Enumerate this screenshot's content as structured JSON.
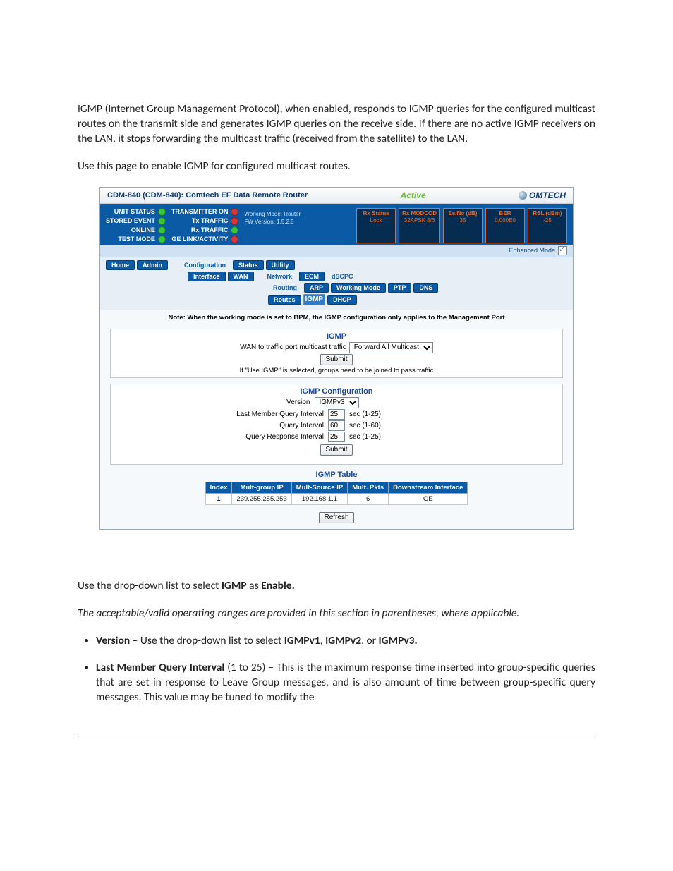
{
  "intro": {
    "p1": "IGMP (Internet Group Management Protocol), when enabled, responds to IGMP queries for the configured multicast routes on the transmit side and generates IGMP queries on the receive side. If there are no active IGMP receivers on the LAN, it stops forwarding the multicast traffic (received from the satellite) to the LAN.",
    "p2": "Use this page to enable IGMP for configured multicast routes."
  },
  "topbar": {
    "title": "CDM-840 (CDM-840): Comtech EF Data Remote Router",
    "active": "Active",
    "logo": "OMTECH"
  },
  "status": {
    "col1": [
      {
        "label": "UNIT STATUS",
        "led": "green"
      },
      {
        "label": "STORED EVENT",
        "led": "green"
      },
      {
        "label": "ONLINE",
        "led": "green"
      },
      {
        "label": "TEST MODE",
        "led": "green"
      }
    ],
    "col2": [
      {
        "label": "TRANSMITTER ON",
        "led": "red"
      },
      {
        "label": "Tx TRAFFIC",
        "led": "red"
      },
      {
        "label": "Rx TRAFFIC",
        "led": "green"
      },
      {
        "label": "GE LINK/ACTIVITY",
        "led": "red"
      }
    ],
    "mid1": "Working Mode: Router",
    "mid2": "FW Version: 1.5.2.5",
    "frames": [
      {
        "hdr": "Rx Status",
        "val": "Lock"
      },
      {
        "hdr": "Rx MODCOD",
        "val": "32APSK 5/6"
      },
      {
        "hdr": "Es/No (dB)",
        "val": "35"
      },
      {
        "hdr": "BER",
        "val": "0.000E0"
      },
      {
        "hdr": "RSL (dBm)",
        "val": "-25"
      }
    ]
  },
  "enhanced_label": "Enhanced Mode",
  "nav": {
    "row1": [
      "Home",
      "Admin"
    ],
    "row1b": [
      "Configuration",
      "Status",
      "Utility"
    ],
    "row2": [
      "Interface",
      "WAN"
    ],
    "row2b": [
      "Network",
      "ECM",
      "dSCPC"
    ],
    "row3": [
      "Routing",
      "ARP",
      "Working Mode",
      "PTP",
      "DNS"
    ],
    "row4": [
      "Routes",
      "IGMP",
      "DHCP"
    ]
  },
  "note_line": "Note: When the working mode is set to BPM, the IGMP configuration only applies to the Management Port",
  "igmp_panel": {
    "title": "IGMP",
    "wan_label": "WAN to traffic port multicast traffic",
    "wan_select": "Forward All Multicast",
    "submit": "Submit",
    "hint": "If \"Use IGMP\" is selected, groups need to be joined to pass traffic"
  },
  "igmp_cfg": {
    "title": "IGMP Configuration",
    "version_label": "Version",
    "version_val": "IGMPv3",
    "rows": [
      {
        "label": "Last Member Query Interval",
        "val": "25",
        "range": "sec (1-25)"
      },
      {
        "label": "Query Interval",
        "val": "60",
        "range": "sec (1-60)"
      },
      {
        "label": "Query Response Interval",
        "val": "25",
        "range": "sec (1-25)"
      }
    ],
    "submit": "Submit"
  },
  "igmp_table": {
    "title": "IGMP Table",
    "headers": [
      "Index",
      "Mult-group IP",
      "Mult-Source IP",
      "Mult. Pkts",
      "Downstream Interface"
    ],
    "row": [
      "1",
      "239.255.255.253",
      "192.168.1.1",
      "6",
      "GE"
    ],
    "refresh": "Refresh"
  },
  "after": {
    "p1_pre": "Use the drop-down list to select ",
    "p1_b1": "IGMP",
    "p1_mid": " as ",
    "p1_b2": "Enable.",
    "p2": "The acceptable/valid operating ranges are provided in this section in parentheses, where applicable.",
    "li1_b": "Version",
    "li1_mid": " – Use the drop-down list to select ",
    "li1_b2": "IGMPv1",
    "li1_c": ", ",
    "li1_b3": "IGMPv2",
    "li1_c2": ", or ",
    "li1_b4": "IGMPv3.",
    "li2_b": "Last Member Query Interval",
    "li2_rest": " (1 to 25) – This is the maximum response time inserted into group-specific queries that are set in response to Leave Group messages, and is also amount of time between group-specific query messages. This value may be tuned to modify the"
  }
}
